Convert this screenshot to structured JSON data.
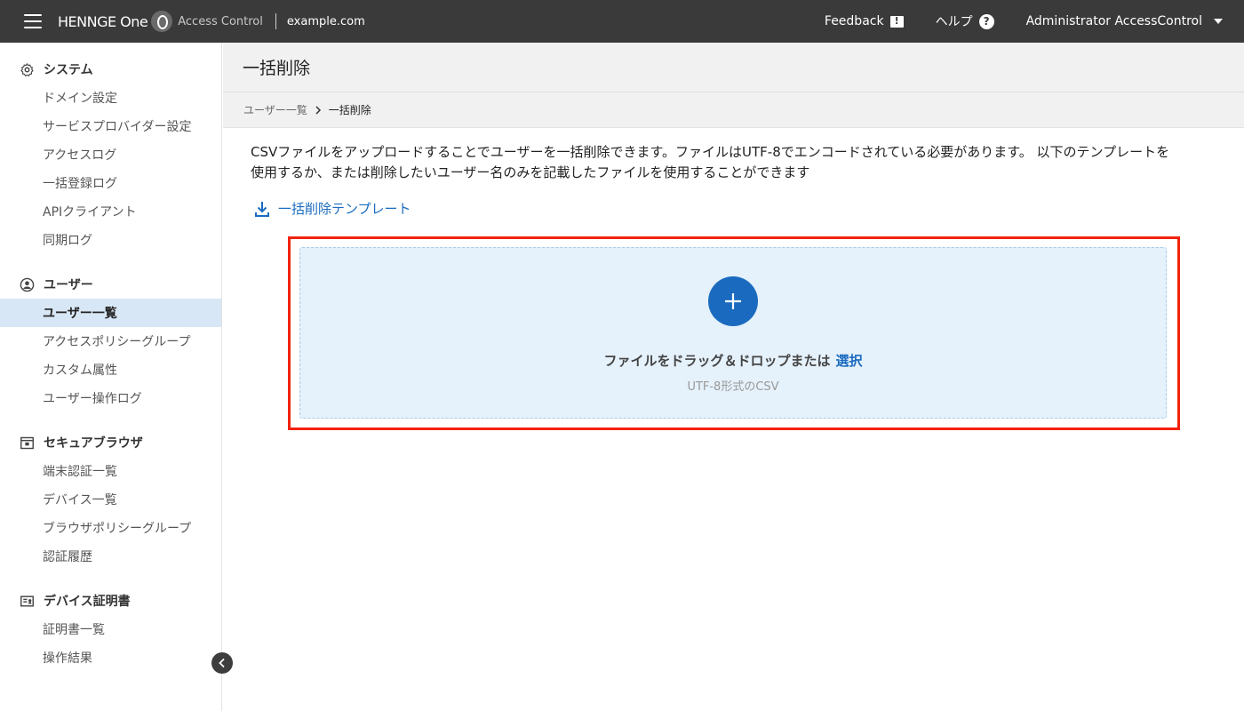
{
  "topbar": {
    "brand": "HENNGE One",
    "product": "Access Control",
    "tenant": "example.com",
    "feedback": "Feedback",
    "help": "ヘルプ",
    "user": "Administrator AccessControl"
  },
  "sidebar": {
    "system": {
      "title": "システム",
      "items": [
        "ドメイン設定",
        "サービスプロバイダー設定",
        "アクセスログ",
        "一括登録ログ",
        "APIクライアント",
        "同期ログ"
      ]
    },
    "users": {
      "title": "ユーザー",
      "items": [
        "ユーザー一覧",
        "アクセスポリシーグループ",
        "カスタム属性",
        "ユーザー操作ログ"
      ]
    },
    "secure_browser": {
      "title": "セキュアブラウザ",
      "items": [
        "端末認証一覧",
        "デバイス一覧",
        "ブラウザポリシーグループ",
        "認証履歴"
      ]
    },
    "device_cert": {
      "title": "デバイス証明書",
      "items": [
        "証明書一覧",
        "操作結果"
      ]
    }
  },
  "main": {
    "title": "一括削除",
    "breadcrumb": {
      "parent": "ユーザー一覧",
      "current": "一括削除"
    },
    "description": "CSVファイルをアップロードすることでユーザーを一括削除できます。ファイルはUTF-8でエンコードされている必要があります。 以下のテンプレートを使用するか、または削除したいユーザー名のみを記載したファイルを使用することができます",
    "template_link": "一括削除テンプレート",
    "dropzone": {
      "text": "ファイルをドラッグ＆ドロップまたは",
      "select": "選択",
      "hint": "UTF-8形式のCSV"
    }
  },
  "colors": {
    "topbar": "#3a3a3a",
    "accent": "#1a6bbf",
    "active_nav": "#d8e7f5",
    "highlight": "#f2220d",
    "dropzone_bg": "#e5f1fb"
  }
}
